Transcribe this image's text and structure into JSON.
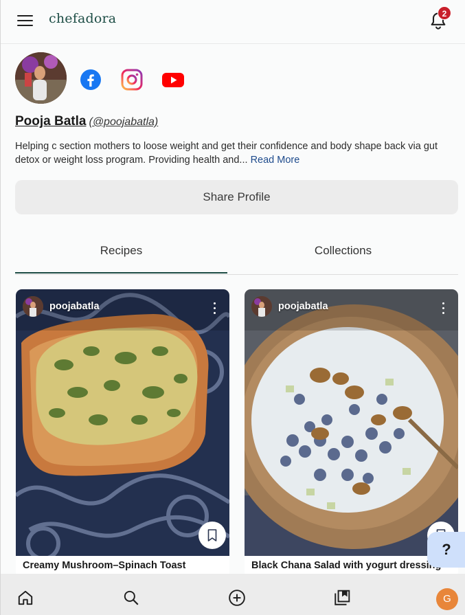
{
  "header": {
    "brand": "chefadora",
    "notification_count": "2"
  },
  "profile": {
    "name": "Pooja Batla",
    "handle": "(@poojabatla)",
    "bio": "Helping c section mothers to loose weight and get their confidence and body shape back via gut detox or weight loss program. Providing health and...",
    "read_more": "Read More",
    "share_label": "Share Profile",
    "socials": [
      "facebook-icon",
      "instagram-icon",
      "youtube-icon"
    ]
  },
  "tabs": [
    {
      "label": "Recipes",
      "active": true
    },
    {
      "label": "Collections",
      "active": false
    }
  ],
  "recipes": [
    {
      "username": "poojabatla",
      "title": "Creamy Mushroom–Spinach Toast"
    },
    {
      "username": "poojabatla",
      "title": "Black Chana Salad with yogurt dressing"
    }
  ],
  "help_label": "?",
  "bottom_nav": {
    "items": [
      "home-icon",
      "search-icon",
      "add-icon",
      "collections-icon"
    ],
    "avatar_initial": "G"
  },
  "colors": {
    "brand": "#1d4d45",
    "badge": "#c8202b",
    "link": "#1e4b8c",
    "help_bg": "#cfe0fb",
    "avatar_bg": "#e8863a"
  }
}
